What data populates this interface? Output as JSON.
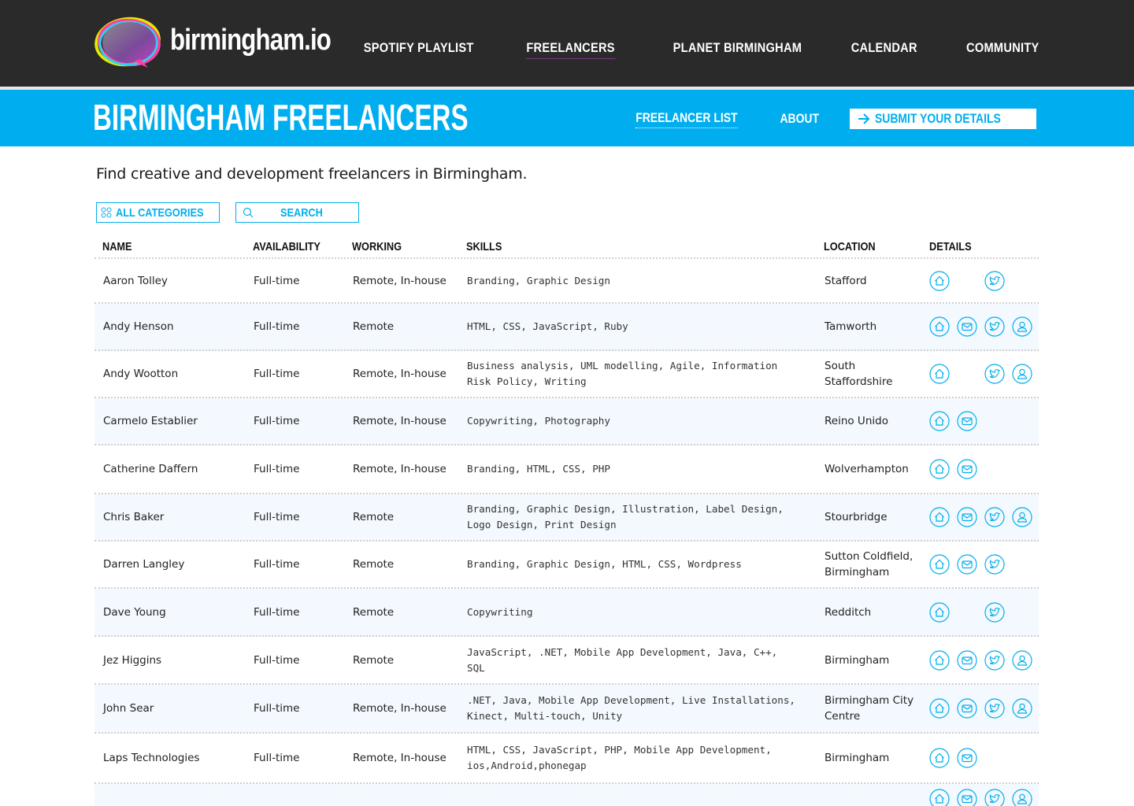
{
  "brand": {
    "name": "birmingham.io"
  },
  "main_nav": [
    {
      "label": "SPOTIFY PLAYLIST",
      "active": false
    },
    {
      "label": "FREELANCERS",
      "active": true
    },
    {
      "label": "PLANET BIRMINGHAM",
      "active": false
    },
    {
      "label": "CALENDAR",
      "active": false
    },
    {
      "label": "COMMUNITY",
      "active": false
    }
  ],
  "header": {
    "title": "BIRMINGHAM FREELANCERS",
    "subnav": {
      "freelancer_list": "FREELANCER LIST",
      "about": "ABOUT",
      "submit": "SUBMIT YOUR DETAILS"
    }
  },
  "intro": "Find creative and development freelancers in Birmingham.",
  "filters": {
    "categories_label": "ALL CATEGORIES",
    "search_label": "SEARCH"
  },
  "table": {
    "headers": {
      "name": "NAME",
      "availability": "AVAILABILITY",
      "working": "WORKING",
      "skills": "SKILLS",
      "location": "LOCATION",
      "details": "DETAILS"
    },
    "rows": [
      {
        "name": "Aaron Tolley",
        "availability": "Full-time",
        "working": "Remote, In-house",
        "skills": "Branding, Graphic Design",
        "location": "Stafford",
        "links": {
          "home": true,
          "email": false,
          "twitter": true,
          "profile": false
        }
      },
      {
        "name": "Andy Henson",
        "availability": "Full-time",
        "working": "Remote",
        "skills": "HTML, CSS, JavaScript, Ruby",
        "location": "Tamworth",
        "links": {
          "home": true,
          "email": true,
          "twitter": true,
          "profile": true
        }
      },
      {
        "name": "Andy Wootton",
        "availability": "Full-time",
        "working": "Remote, In-house",
        "skills": "Business analysis, UML modelling, Agile, Information Risk Policy, Writing",
        "location": "South Staffordshire",
        "links": {
          "home": true,
          "email": false,
          "twitter": true,
          "profile": true
        }
      },
      {
        "name": "Carmelo Establier",
        "availability": "Full-time",
        "working": "Remote, In-house",
        "skills": "Copywriting, Photography",
        "location": "Reino Unido",
        "links": {
          "home": true,
          "email": true,
          "twitter": false,
          "profile": false
        }
      },
      {
        "name": "Catherine Daffern",
        "availability": "Full-time",
        "working": "Remote, In-house",
        "skills": "Branding, HTML, CSS, PHP",
        "location": "Wolverhampton",
        "links": {
          "home": true,
          "email": true,
          "twitter": false,
          "profile": false
        }
      },
      {
        "name": "Chris Baker",
        "availability": "Full-time",
        "working": "Remote",
        "skills": "Branding, Graphic Design, Illustration, Label Design, Logo Design, Print Design",
        "location": "Stourbridge",
        "links": {
          "home": true,
          "email": true,
          "twitter": true,
          "profile": true
        }
      },
      {
        "name": "Darren Langley",
        "availability": "Full-time",
        "working": "Remote",
        "skills": "Branding, Graphic Design, HTML, CSS, Wordpress",
        "location": "Sutton Coldfield, Birmingham",
        "links": {
          "home": true,
          "email": true,
          "twitter": true,
          "profile": false
        }
      },
      {
        "name": "Dave Young",
        "availability": "Full-time",
        "working": "Remote",
        "skills": "Copywriting",
        "location": "Redditch",
        "links": {
          "home": true,
          "email": false,
          "twitter": true,
          "profile": false
        }
      },
      {
        "name": "Jez Higgins",
        "availability": "Full-time",
        "working": "Remote",
        "skills": "JavaScript, .NET, Mobile App Development, Java, C++, SQL",
        "location": "Birmingham",
        "links": {
          "home": true,
          "email": true,
          "twitter": true,
          "profile": true
        }
      },
      {
        "name": "John Sear",
        "availability": "Full-time",
        "working": "Remote, In-house",
        "skills": ".NET, Java, Mobile App Development, Live Installations, Kinect, Multi-touch, Unity",
        "location": "Birmingham City Centre",
        "links": {
          "home": true,
          "email": true,
          "twitter": true,
          "profile": true
        }
      },
      {
        "name": "Laps Technologies",
        "availability": "Full-time",
        "working": "Remote, In-house",
        "skills": "HTML, CSS, JavaScript, PHP, Mobile App Development, ios,Android,phonegap",
        "location": "Birmingham",
        "links": {
          "home": true,
          "email": true,
          "twitter": false,
          "profile": false
        }
      },
      {
        "name": "",
        "availability": "",
        "working": "",
        "skills": "",
        "location": "",
        "links": {
          "home": true,
          "email": true,
          "twitter": true,
          "profile": true
        }
      }
    ]
  },
  "colors": {
    "topbar": "#2a2a2a",
    "accent": "#00aeef",
    "row_alt": "#f3f9fe"
  }
}
